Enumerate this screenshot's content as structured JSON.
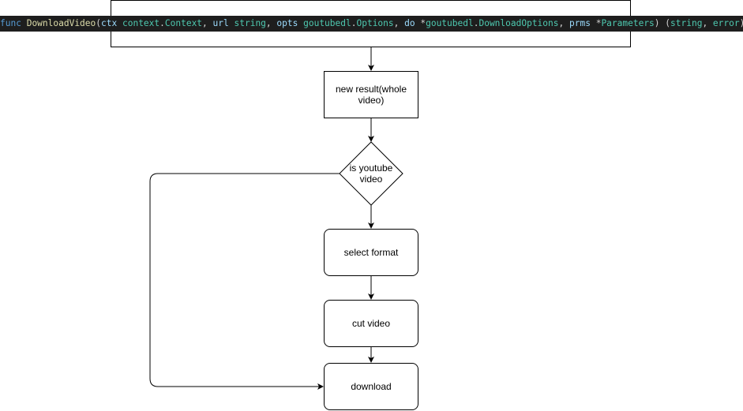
{
  "code_signature": {
    "tokens": [
      {
        "text": "func",
        "kind": "kw"
      },
      {
        "text": " ",
        "kind": "punc"
      },
      {
        "text": "DownloadVideo",
        "kind": "fn"
      },
      {
        "text": "(",
        "kind": "punc"
      },
      {
        "text": "ctx",
        "kind": "param"
      },
      {
        "text": " ",
        "kind": "punc"
      },
      {
        "text": "context",
        "kind": "type"
      },
      {
        "text": ".",
        "kind": "punc"
      },
      {
        "text": "Context",
        "kind": "type"
      },
      {
        "text": ", ",
        "kind": "punc"
      },
      {
        "text": "url",
        "kind": "param"
      },
      {
        "text": " ",
        "kind": "punc"
      },
      {
        "text": "string",
        "kind": "type"
      },
      {
        "text": ", ",
        "kind": "punc"
      },
      {
        "text": "opts",
        "kind": "param"
      },
      {
        "text": " ",
        "kind": "punc"
      },
      {
        "text": "goutubedl",
        "kind": "type"
      },
      {
        "text": ".",
        "kind": "punc"
      },
      {
        "text": "Options",
        "kind": "type"
      },
      {
        "text": ", ",
        "kind": "punc"
      },
      {
        "text": "do",
        "kind": "param"
      },
      {
        "text": " *",
        "kind": "punc"
      },
      {
        "text": "goutubedl",
        "kind": "type"
      },
      {
        "text": ".",
        "kind": "punc"
      },
      {
        "text": "DownloadOptions",
        "kind": "type"
      },
      {
        "text": ", ",
        "kind": "punc"
      },
      {
        "text": "prms",
        "kind": "param"
      },
      {
        "text": " *",
        "kind": "punc"
      },
      {
        "text": "Parameters",
        "kind": "type"
      },
      {
        "text": ") (",
        "kind": "punc"
      },
      {
        "text": "string",
        "kind": "type"
      },
      {
        "text": ", ",
        "kind": "punc"
      },
      {
        "text": "error",
        "kind": "type"
      },
      {
        "text": ") {",
        "kind": "punc"
      }
    ]
  },
  "nodes": {
    "new_result": "new result(whole video)",
    "is_youtube": "is youtube video",
    "select_format": "select format",
    "cut_video": "cut video",
    "download": "download"
  },
  "colors": {
    "code_background": "#1e1e1e",
    "keyword": "#569cd6",
    "function": "#dcdcaa",
    "parameter": "#9cdcfe",
    "type": "#4ec9b0",
    "punctuation": "#d4d4d4",
    "stroke": "#000000"
  }
}
